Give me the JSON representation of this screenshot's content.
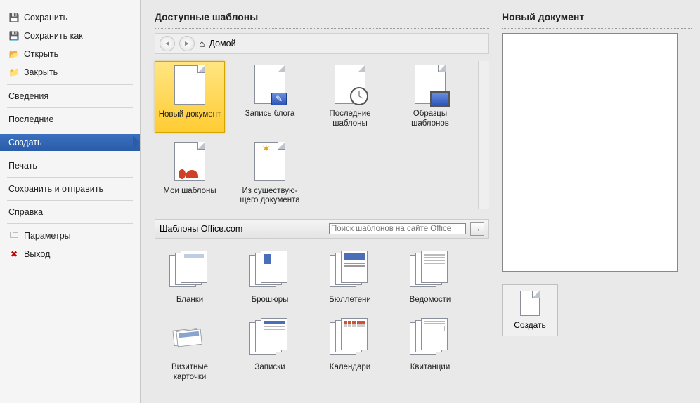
{
  "sidebar": {
    "items": [
      {
        "label": "Сохранить",
        "icon": "save-icon"
      },
      {
        "label": "Сохранить как",
        "icon": "save-as-icon"
      },
      {
        "label": "Открыть",
        "icon": "folder-open-icon"
      },
      {
        "label": "Закрыть",
        "icon": "folder-close-icon"
      },
      {
        "label": "Сведения",
        "icon": ""
      },
      {
        "label": "Последние",
        "icon": ""
      },
      {
        "label": "Создать",
        "icon": "",
        "active": true
      },
      {
        "label": "Печать",
        "icon": ""
      },
      {
        "label": "Сохранить и отправить",
        "icon": ""
      },
      {
        "label": "Справка",
        "icon": ""
      },
      {
        "label": "Параметры",
        "icon": "options-icon"
      },
      {
        "label": "Выход",
        "icon": "exit-icon"
      }
    ]
  },
  "center": {
    "title": "Доступные шаблоны",
    "breadcrumb": "Домой",
    "tiles_top": [
      {
        "label": "Новый документ",
        "selected": true,
        "type": "blank"
      },
      {
        "label": "Запись блога",
        "type": "blog"
      },
      {
        "label": "Последние шаблоны",
        "type": "recent"
      },
      {
        "label": "Образцы шаблонов",
        "type": "samples"
      },
      {
        "label": "Мои шаблоны",
        "type": "my"
      },
      {
        "label": "Из существую­щего документа",
        "type": "existing"
      }
    ],
    "office_section": "Шаблоны Office.com",
    "search_placeholder": "Поиск шаблонов на сайте Office",
    "tiles_bottom": [
      {
        "label": "Бланки"
      },
      {
        "label": "Брошюры"
      },
      {
        "label": "Бюллетени"
      },
      {
        "label": "Ведомости"
      },
      {
        "label": "Визитные карточки"
      },
      {
        "label": "Записки"
      },
      {
        "label": "Календари"
      },
      {
        "label": "Квитанции"
      }
    ]
  },
  "right": {
    "title": "Новый документ",
    "create_label": "Создать"
  }
}
